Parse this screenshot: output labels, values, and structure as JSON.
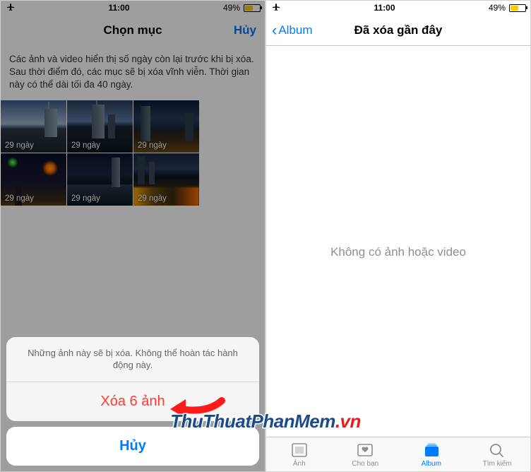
{
  "status": {
    "time": "11:00",
    "battery": "49%"
  },
  "left": {
    "nav": {
      "title": "Chọn mục",
      "cancel": "Hủy"
    },
    "description": "Các ảnh và video hiển thị số ngày còn lại trước khi bị xóa. Sau thời điểm đó, các mục sẽ bị xóa vĩnh viễn. Thời gian này có thể dài tối đa 40 ngày.",
    "thumbs": [
      {
        "label": "29 ngày"
      },
      {
        "label": "29 ngày"
      },
      {
        "label": "29 ngày"
      },
      {
        "label": "29 ngày"
      },
      {
        "label": "29 ngày"
      },
      {
        "label": "29 ngày"
      }
    ],
    "sheet": {
      "message": "Những ảnh này sẽ bị xóa. Không thể hoàn tác hành động này.",
      "delete": "Xóa 6 ảnh",
      "cancel": "Hủy"
    }
  },
  "right": {
    "nav": {
      "back": "Album",
      "title": "Đã xóa gần đây"
    },
    "empty": "Không có ảnh hoặc video",
    "tabs": {
      "photos": "Ảnh",
      "foryou": "Cho bạn",
      "albums": "Album",
      "search": "Tìm kiếm"
    }
  },
  "watermark": {
    "p1": "ThuThuatPhanMem",
    "p2": ".vn"
  }
}
